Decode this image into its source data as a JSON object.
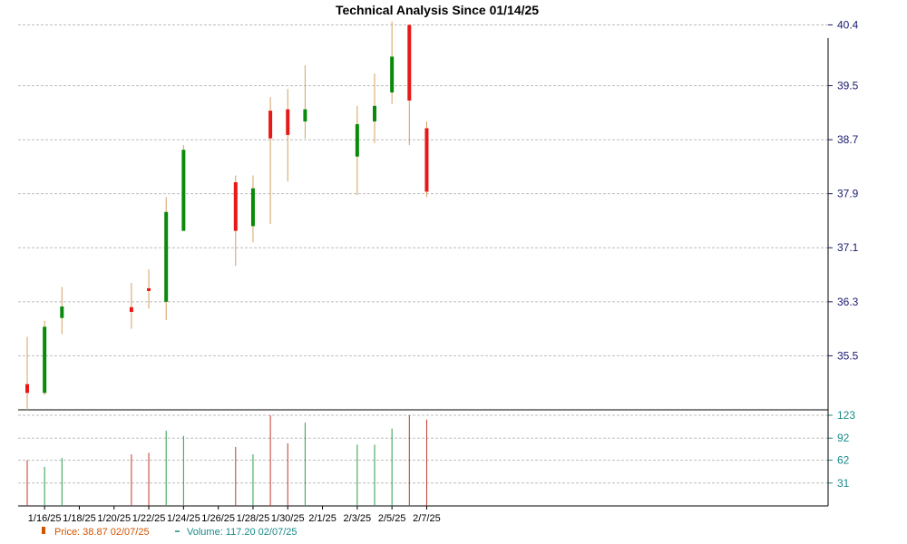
{
  "chart_data": {
    "type": "candlestick",
    "title": "Technical Analysis Since 01/14/25",
    "price_axis": {
      "range": [
        34.7,
        40.5
      ],
      "ticks": [
        "35.5",
        "36.3",
        "37.1",
        "37.9",
        "38.7",
        "39.5",
        "40.4"
      ]
    },
    "volume_axis": {
      "range": [
        0,
        123
      ],
      "ticks": [
        "31",
        "62",
        "92",
        "123"
      ]
    },
    "x_tick_labels": [
      "1/16/25",
      "1/18/25",
      "1/20/25",
      "1/22/25",
      "1/24/25",
      "1/26/25",
      "1/28/25",
      "1/30/25",
      "2/1/25",
      "2/3/25",
      "2/5/25",
      "2/7/25"
    ],
    "grid": true,
    "candles": [
      {
        "date": "1/15/25",
        "open": 35.08,
        "close": 34.95,
        "high": 35.78,
        "low": 34.7,
        "volume": 62
      },
      {
        "date": "1/16/25",
        "open": 34.95,
        "close": 35.93,
        "high": 36.02,
        "low": 34.92,
        "volume": 53
      },
      {
        "date": "1/17/25",
        "open": 36.06,
        "close": 36.23,
        "high": 36.52,
        "low": 35.82,
        "volume": 65
      },
      {
        "date": "1/21/25",
        "open": 36.22,
        "close": 36.15,
        "high": 36.58,
        "low": 35.9,
        "volume": 70
      },
      {
        "date": "1/22/25",
        "open": 36.5,
        "close": 36.48,
        "high": 36.78,
        "low": 36.2,
        "volume": 72
      },
      {
        "date": "1/23/25",
        "open": 36.3,
        "close": 37.63,
        "high": 37.85,
        "low": 36.03,
        "volume": 102
      },
      {
        "date": "1/24/25",
        "open": 37.35,
        "close": 38.55,
        "high": 38.62,
        "low": 37.35,
        "volume": 95
      },
      {
        "date": "1/27/25",
        "open": 38.07,
        "close": 37.35,
        "high": 38.17,
        "low": 36.83,
        "volume": 80
      },
      {
        "date": "1/28/25",
        "open": 37.42,
        "close": 37.98,
        "high": 38.17,
        "low": 37.18,
        "volume": 70
      },
      {
        "date": "1/29/25",
        "open": 39.13,
        "close": 38.72,
        "high": 39.33,
        "low": 37.45,
        "volume": 123
      },
      {
        "date": "1/30/25",
        "open": 39.15,
        "close": 38.77,
        "high": 39.45,
        "low": 38.08,
        "volume": 85
      },
      {
        "date": "1/31/25",
        "open": 38.97,
        "close": 39.15,
        "high": 39.8,
        "low": 38.72,
        "volume": 113
      },
      {
        "date": "2/3/25",
        "open": 38.45,
        "close": 38.93,
        "high": 39.2,
        "low": 37.88,
        "volume": 83
      },
      {
        "date": "2/4/25",
        "open": 38.97,
        "close": 39.2,
        "high": 39.68,
        "low": 38.65,
        "volume": 83
      },
      {
        "date": "2/5/25",
        "open": 39.4,
        "close": 39.93,
        "high": 40.45,
        "low": 39.23,
        "volume": 105
      },
      {
        "date": "2/6/25",
        "open": 40.4,
        "close": 39.28,
        "high": 40.4,
        "low": 38.62,
        "volume": 123
      },
      {
        "date": "2/7/25",
        "open": 38.87,
        "close": 37.93,
        "high": 38.97,
        "low": 37.85,
        "volume": 117.2
      }
    ],
    "legend": {
      "price_label": "Price: 38.87  02/07/25",
      "volume_label": "Volume: 117.20  02/07/25"
    },
    "colors": {
      "up": "#0a8a0a",
      "down": "#e81818",
      "wick": "#d4a060",
      "vol_up": "#2a9d4a",
      "vol_down": "#c0392b",
      "price_axis_text": "#1a1a6e",
      "volume_axis_text": "#1a8a8a",
      "legend_price": "#d35400",
      "legend_volume": "#1a8a8a"
    }
  }
}
